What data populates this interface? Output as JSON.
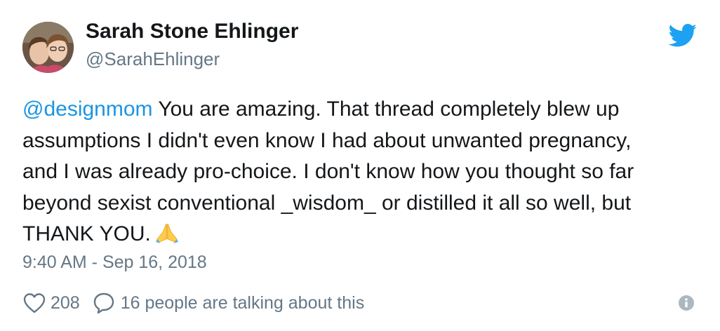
{
  "tweet": {
    "author": {
      "name": "Sarah Stone Ehlinger",
      "handle": "@SarahEhlinger"
    },
    "text_lines": [
      {
        "mention": "@designmom",
        "text": " You are amazing. That thread completely blew up"
      },
      {
        "text": "assumptions I didn't even know I had about unwanted pregnancy,"
      },
      {
        "text": "and I was already pro-choice.  I don't know how you thought so far"
      },
      {
        "text": "beyond sexist conventional _wisdom_ or distilled it all so well, but"
      },
      {
        "text": "THANK YOU."
      }
    ],
    "emoji": "folded-hands",
    "timestamp": "9:40 AM - Sep 16, 2018",
    "likes": "208",
    "replies_label": "16 people are talking about this"
  },
  "icons": {
    "brand": "twitter-bird-icon",
    "like": "heart-icon",
    "reply": "speech-bubble-icon",
    "info": "info-icon"
  },
  "colors": {
    "brand_blue": "#1da1f2",
    "mention_blue": "#1b95e0",
    "text": "#14171a",
    "muted": "#657786",
    "info_icon": "#aab8c2"
  }
}
